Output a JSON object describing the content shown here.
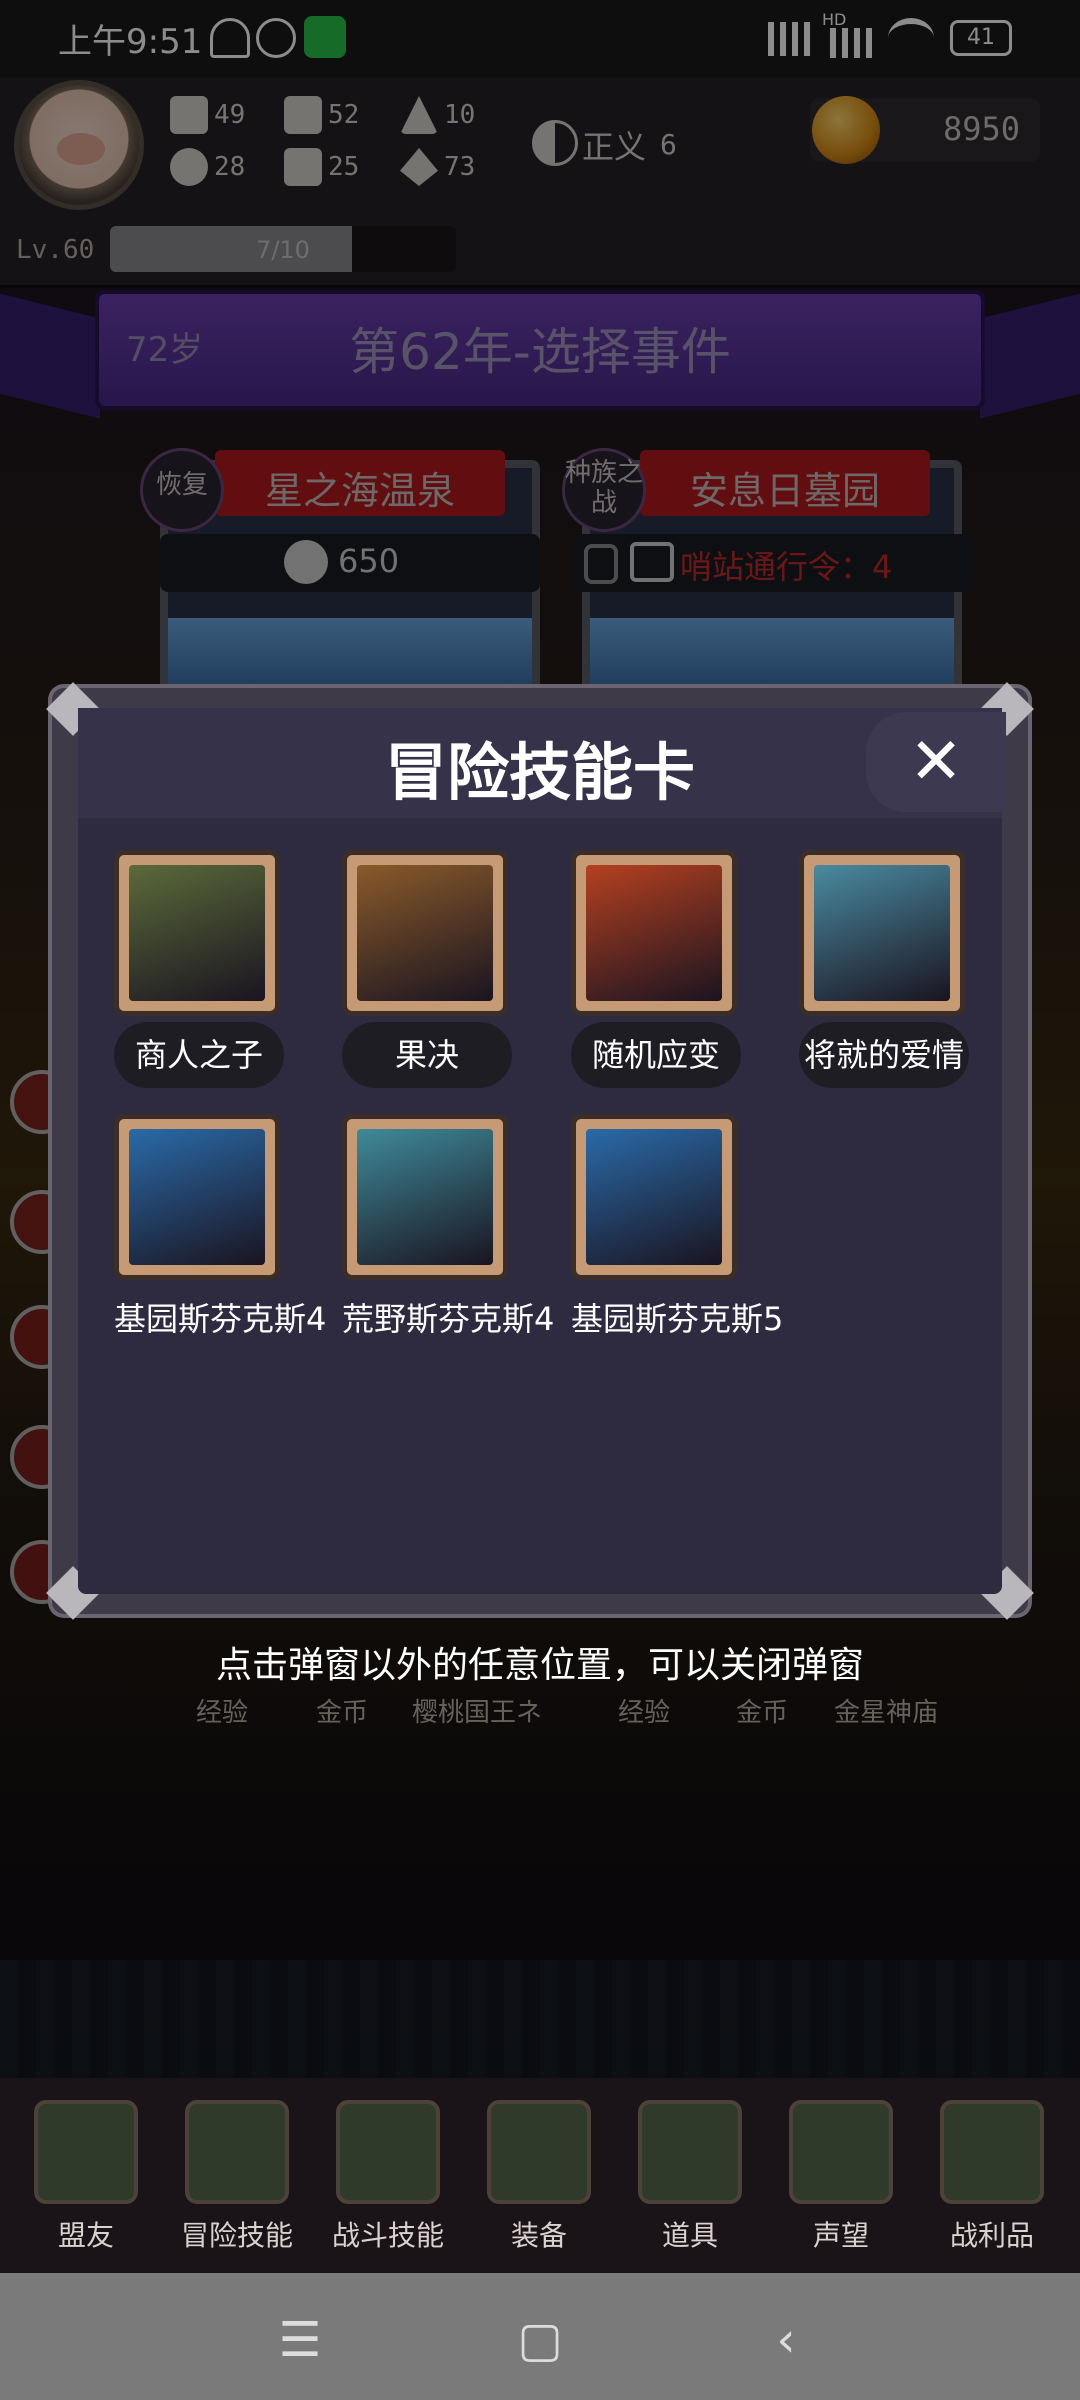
{
  "status_bar": {
    "time": "上午9:51",
    "signal_label": "HD",
    "battery": "41"
  },
  "player": {
    "stats": [
      {
        "icon": "fist-icon",
        "value": "49"
      },
      {
        "icon": "boot-icon",
        "value": "52"
      },
      {
        "icon": "wizard-hat-icon",
        "value": "10"
      },
      {
        "icon": "clover-icon",
        "value": "28"
      },
      {
        "icon": "scroll-icon",
        "value": "25"
      },
      {
        "icon": "leaf-icon",
        "value": "73"
      }
    ],
    "alignment_label": "正义",
    "alignment_value": "6",
    "gold": "8950",
    "level": "Lv.60",
    "xp_text": "7/10",
    "xp_fraction": 0.7
  },
  "banner": {
    "age": "72岁",
    "title": "第62年-选择事件"
  },
  "events": [
    {
      "badge": "恢复",
      "title": "星之海温泉",
      "cost": "650",
      "cost_color": "#cfcfcf"
    },
    {
      "badge": "种族之战",
      "title": "安息日墓园",
      "cost": "哨站通行令：4",
      "cost_color": "#c42a2a"
    }
  ],
  "rewards_behind": [
    "经验",
    "金币",
    "樱桃国王ネ",
    "经验",
    "金币",
    "金星神庙"
  ],
  "modal": {
    "title": "冒险技能卡",
    "close_label": "✕",
    "skills": [
      {
        "name": "商人之子",
        "art_color": "#5b6a3a"
      },
      {
        "name": "果决",
        "art_color": "#8a5a2a"
      },
      {
        "name": "随机应变",
        "art_color": "#b54020"
      },
      {
        "name": "将就的爱情",
        "art_color": "#4a8aa0"
      },
      {
        "name": "基园斯芬克斯4",
        "art_color": "#2a6aa8"
      },
      {
        "name": "荒野斯芬克斯4",
        "art_color": "#3f8a9a"
      },
      {
        "name": "基园斯芬克斯5",
        "art_color": "#2a6aa8"
      }
    ]
  },
  "hint": "点击弹窗以外的任意位置，可以关闭弹窗",
  "bottom_nav": [
    {
      "label": "盟友",
      "icon": "handshake-icon"
    },
    {
      "label": "冒险技能",
      "icon": "book-icon"
    },
    {
      "label": "战斗技能",
      "icon": "backpack-icon"
    },
    {
      "label": "装备",
      "icon": "crossed-swords-icon"
    },
    {
      "label": "道具",
      "icon": "satchel-icon"
    },
    {
      "label": "声望",
      "icon": "scroll-icon"
    },
    {
      "label": "战利品",
      "icon": "treasure-chest-icon"
    }
  ],
  "system_nav": {
    "menu": "☰",
    "home": "▢",
    "back": "‹"
  }
}
